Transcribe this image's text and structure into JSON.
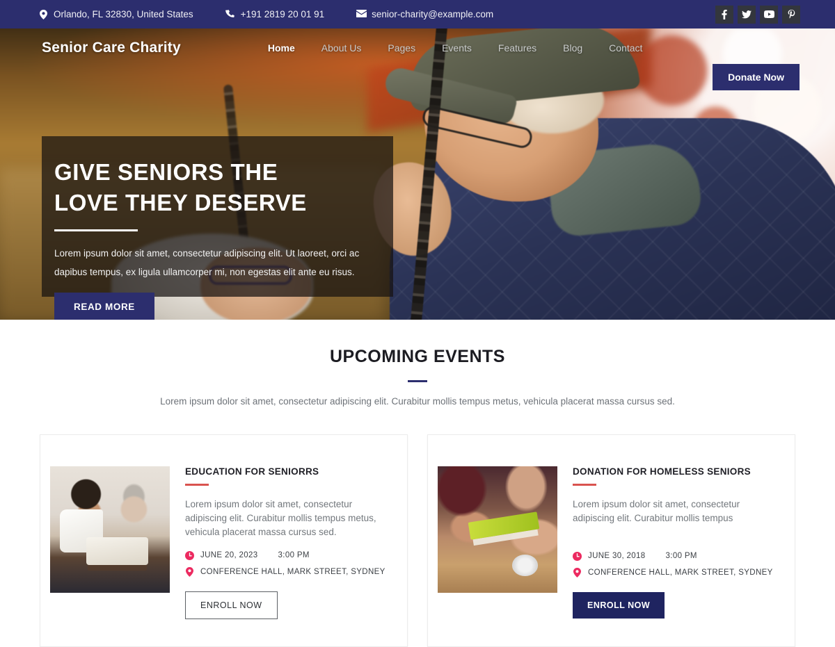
{
  "topbar": {
    "address": "Orlando, FL 32830, United States",
    "phone": "+191 2819 20 01 91",
    "email": "senior-charity@example.com",
    "icons": {
      "location": "location-pin-icon",
      "phone": "phone-icon",
      "email": "envelope-icon"
    },
    "socials": [
      {
        "name": "facebook-icon",
        "label": "f"
      },
      {
        "name": "twitter-icon",
        "label": "t"
      },
      {
        "name": "youtube-icon",
        "label": "yt"
      },
      {
        "name": "pinterest-icon",
        "label": "p"
      }
    ]
  },
  "header": {
    "logo": "Senior Care Charity",
    "menu": [
      {
        "label": "Home",
        "active": true
      },
      {
        "label": "About Us",
        "active": false
      },
      {
        "label": "Pages",
        "active": false
      },
      {
        "label": "Events",
        "active": false
      },
      {
        "label": "Features",
        "active": false
      },
      {
        "label": "Blog",
        "active": false
      },
      {
        "label": "Contact",
        "active": false
      }
    ],
    "donate_label": "Donate Now"
  },
  "hero": {
    "title_line1": "GIVE SENIORS THE",
    "title_line2": "LOVE THEY DESERVE",
    "subtitle": "Lorem ipsum dolor sit amet, consectetur adipiscing elit. Ut laoreet, orci ac dapibus tempus, ex ligula ullamcorper mi, non egestas elit ante eu risus.",
    "cta_label": "READ MORE"
  },
  "events": {
    "heading": "UPCOMING EVENTS",
    "subheading": "Lorem ipsum dolor sit amet, consectetur adipiscing elit. Curabitur mollis tempus metus, vehicula placerat massa cursus sed.",
    "cards": [
      {
        "title": "EDUCATION FOR SENIORRS",
        "text": "Lorem ipsum dolor sit amet, consectetur adipiscing elit. Curabitur mollis tempus metus, vehicula placerat massa cursus sed.",
        "date": "JUNE 20, 2023",
        "time": "3:00 PM",
        "location": "CONFERENCE HALL, MARK STREET, SYDNEY",
        "button_label": "ENROLL NOW",
        "button_style": "outline",
        "image_alt": "caregiver-reading-book-with-elderly-man"
      },
      {
        "title": "DONATION FOR HOMELESS SENIORS",
        "text": "Lorem ipsum dolor sit amet, consectetur adipiscing elit. Curabitur mollis tempus",
        "date": "JUNE 30, 2018",
        "time": "3:00 PM",
        "location": "CONFERENCE HALL, MARK STREET, SYDNEY",
        "button_label": "ENROLL NOW",
        "button_style": "filled",
        "image_alt": "hands-exchanging-food-donation-package"
      }
    ],
    "icons": {
      "date": "clock-icon",
      "location": "location-pin-icon"
    }
  },
  "colors": {
    "navy": "#2c2e6e",
    "accent_red": "#d9534f",
    "pink": "#ec2a60",
    "social_tile": "#33363d",
    "heading": "#1c1c22"
  }
}
